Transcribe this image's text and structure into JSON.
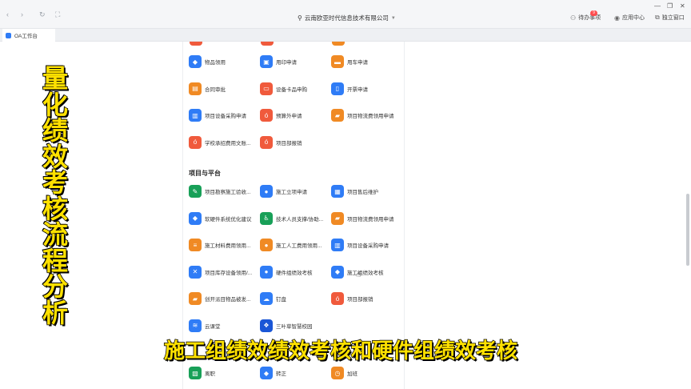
{
  "browser": {
    "org_name": "云南欧亚时代信息技术有限公司",
    "todo_label": "待办事项",
    "todo_badge": "9",
    "app_center_label": "应用中心",
    "standalone_label": "独立窗口"
  },
  "tab": {
    "label": "OA工作台"
  },
  "section": {
    "title": "项目与平台"
  },
  "apps_top": [
    {
      "label": "物品领用",
      "color": "#2f7cf6",
      "icon": "diamond-icon"
    },
    {
      "label": "用印申请",
      "color": "#2f7cf6",
      "icon": "stamp-icon"
    },
    {
      "label": "用车申请",
      "color": "#f08a24",
      "icon": "car-icon"
    },
    {
      "label": "合同审批",
      "color": "#f08a24",
      "icon": "contract-icon"
    },
    {
      "label": "设备卡品申购",
      "color": "#f05a3c",
      "icon": "cart-icon"
    },
    {
      "label": "开票申请",
      "color": "#2f7cf6",
      "icon": "invoice-icon"
    },
    {
      "label": "项目设备采购申请",
      "color": "#2f7cf6",
      "icon": "building-icon"
    },
    {
      "label": "预算外申请",
      "color": "#f05a3c",
      "icon": "money-bag-icon"
    },
    {
      "label": "项目物流费领用申请",
      "color": "#f08a24",
      "icon": "truck-icon"
    },
    {
      "label": "学校承招费用文账...",
      "color": "#f05a3c",
      "icon": "money-bag-icon"
    },
    {
      "label": "项目部报销",
      "color": "#f05a3c",
      "icon": "money-bag-icon"
    }
  ],
  "apps_project": [
    {
      "label": "项目勘察施工验收...",
      "color": "#18a058",
      "icon": "pen-icon"
    },
    {
      "label": "施工立项申请",
      "color": "#2f7cf6",
      "icon": "person-icon"
    },
    {
      "label": "项目售后维护",
      "color": "#2f7cf6",
      "icon": "printer-icon"
    },
    {
      "label": "软硬件系统优化建议",
      "color": "#2f7cf6",
      "icon": "diamond-icon"
    },
    {
      "label": "技术人员支撑/协助...",
      "color": "#18a058",
      "icon": "accessibility-icon"
    },
    {
      "label": "项目物流费领用申请",
      "color": "#f08a24",
      "icon": "truck-icon"
    },
    {
      "label": "施工材料费用领用...",
      "color": "#f08a24",
      "icon": "server-icon"
    },
    {
      "label": "施工人工费用领用...",
      "color": "#f08a24",
      "icon": "person-icon"
    },
    {
      "label": "项目设备采购申请",
      "color": "#2f7cf6",
      "icon": "building-icon"
    },
    {
      "label": "项目库存设备领用/...",
      "color": "#2f7cf6",
      "icon": "tools-icon"
    },
    {
      "label": "硬件组绩效考核",
      "color": "#2f7cf6",
      "icon": "person-icon"
    },
    {
      "label": "施工组绩效考核",
      "color": "#2f7cf6",
      "icon": "diamond-icon"
    },
    {
      "label": "创开派目物品被发...",
      "color": "#f08a24",
      "icon": "truck-icon"
    },
    {
      "label": "钉盘",
      "color": "#2f7cf6",
      "icon": "cloud-icon"
    },
    {
      "label": "项目部报销",
      "color": "#f05a3c",
      "icon": "money-bag-icon"
    },
    {
      "label": "云课堂",
      "color": "#2f7cf6",
      "icon": "layers-icon"
    },
    {
      "label": "三叶草智慧校园",
      "color": "#1a56d6",
      "icon": "clover-icon"
    }
  ],
  "apps_bottom": [
    {
      "label": "离职",
      "color": "#18a058",
      "icon": "resign-icon"
    },
    {
      "label": "转正",
      "color": "#2f7cf6",
      "icon": "diamond-icon"
    },
    {
      "label": "加班",
      "color": "#f08a24",
      "icon": "clock-icon"
    }
  ],
  "overlay": {
    "vertical_title": "量化绩效考核流程分析",
    "caption": "施工组绩效绩效考核和硬件组绩效考核"
  }
}
